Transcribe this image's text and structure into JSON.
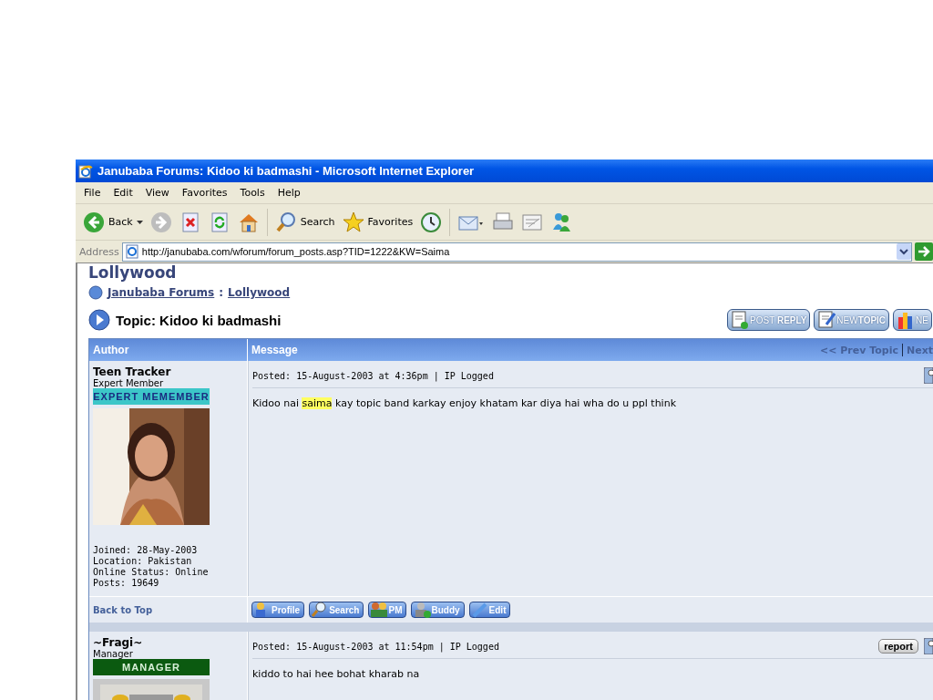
{
  "window": {
    "title": "Janubaba Forums: Kidoo ki badmashi - Microsoft Internet Explorer"
  },
  "menu": [
    "File",
    "Edit",
    "View",
    "Favorites",
    "Tools",
    "Help"
  ],
  "toolbar": [
    {
      "kind": "back",
      "label": "Back"
    },
    {
      "kind": "forward"
    },
    {
      "kind": "stop"
    },
    {
      "kind": "refresh"
    },
    {
      "kind": "home"
    },
    {
      "kind": "search",
      "label": "Search"
    },
    {
      "kind": "favorites",
      "label": "Favorites"
    },
    {
      "kind": "history"
    },
    {
      "kind": "mail"
    },
    {
      "kind": "print"
    },
    {
      "kind": "edit"
    },
    {
      "kind": "messenger"
    }
  ],
  "address": {
    "label": "Address",
    "value": "http://janubaba.com/wforum/forum_posts.asp?TID=1222&KW=Saima"
  },
  "page": {
    "forum_title": "Lollywood",
    "breadcrumb": [
      "Janubaba Forums",
      "Lollywood"
    ],
    "breadcrumb_separator": ":",
    "topic": "Topic: Kidoo ki badmashi",
    "buttons": [
      {
        "kind": "post",
        "label": "POST **REPLY**"
      },
      {
        "kind": "new",
        "label": "NEW**TOPIC**"
      },
      {
        "kind": "poll",
        "label": "NE"
      }
    ]
  },
  "table": {
    "columns": [
      "Author",
      "Message"
    ],
    "nav": [
      "<< Prev Topic",
      "Next"
    ],
    "posts": [
      {
        "author": "Teen Tracker",
        "rank": "Expert Member",
        "badge": {
          "text": "EXPERT MEMEMBER",
          "color": "#3cc6c8"
        },
        "avatar": {
          "kind": "picture"
        },
        "details": [
          "Joined: 28-May-2003",
          "Location: Pakistan",
          "Online Status: Online",
          "Posts: 19649"
        ],
        "posted": "Posted: 15-August-2003 at 4:36pm | IP Logged",
        "report": false,
        "message": [
          {
            "text": "Kidoo nai ",
            "highlight": false
          },
          {
            "text": "saima",
            "highlight": true
          },
          {
            "text": " kay topic band karkay enjoy khatam kar diya hai wha do u ppl think",
            "highlight": false
          }
        ],
        "footer": {
          "link": "Back to Top",
          "buttons": [
            {
              "kind": "profile",
              "label": "Profile"
            },
            {
              "kind": "search",
              "label": "Search"
            },
            {
              "kind": "pm",
              "label": "PM"
            },
            {
              "kind": "buddy",
              "label": "Buddy"
            },
            {
              "kind": "edit",
              "label": "Edit"
            }
          ]
        }
      },
      {
        "author": "~Fragi~",
        "rank": "Manager",
        "badge": {
          "text": "MANAGER",
          "color": "#0b5a10"
        },
        "avatar": {
          "kind": "picture"
        },
        "posted": "Posted: 15-August-2003 at 11:54pm | IP Logged",
        "report": true,
        "report_label": "report",
        "message": [
          {
            "text": "kiddo to hai hee bohat kharab na",
            "highlight": false
          }
        ]
      }
    ]
  }
}
